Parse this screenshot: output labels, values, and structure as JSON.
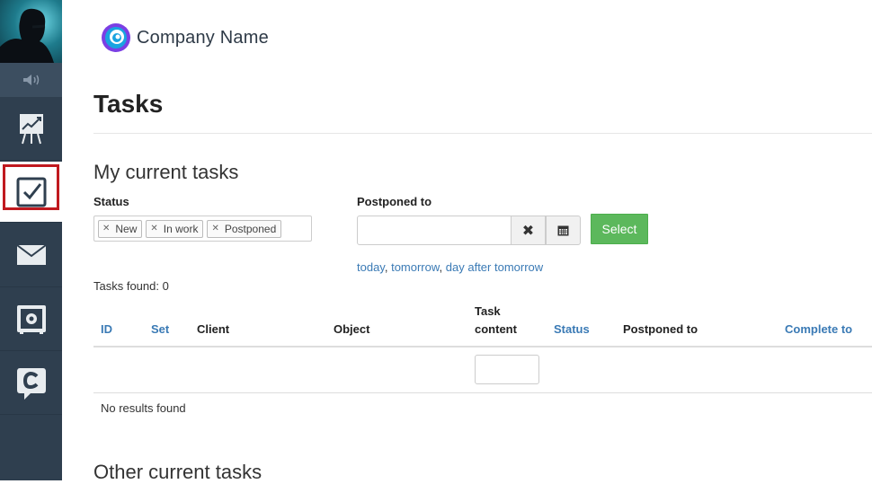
{
  "app": {
    "company_name": "Company Name",
    "page_title": "Tasks"
  },
  "sidebar": {
    "items": [
      {
        "name": "analytics",
        "icon": "chart-board-icon"
      },
      {
        "name": "tasks",
        "icon": "checkbox-icon",
        "active": true
      },
      {
        "name": "mail",
        "icon": "envelope-icon"
      },
      {
        "name": "safe",
        "icon": "safe-icon"
      },
      {
        "name": "chat",
        "icon": "c-chat-icon"
      }
    ],
    "sound_icon": "speaker-icon"
  },
  "my_tasks": {
    "title": "My current tasks",
    "status_label": "Status",
    "status_tags": [
      "New",
      "In work",
      "Postponed"
    ],
    "postponed_label": "Postponed to",
    "postponed_value": "",
    "select_label": "Select",
    "quick_links": [
      "today",
      "tomorrow",
      "day after tomorrow"
    ],
    "tasks_found": "Tasks found: 0",
    "columns": {
      "id": "ID",
      "set": "Set",
      "client": "Client",
      "object": "Object",
      "task_content_1": "Task",
      "task_content_2": "content",
      "status": "Status",
      "postponed_to": "Postponed to",
      "complete_to": "Complete to"
    },
    "no_results": "No results found"
  },
  "other_tasks": {
    "title": "Other current tasks"
  },
  "colors": {
    "sidebar": "#2f3f4f",
    "accent_link": "#3a7ab5",
    "select_green": "#5cb85c",
    "active_frame": "#c0191f"
  }
}
